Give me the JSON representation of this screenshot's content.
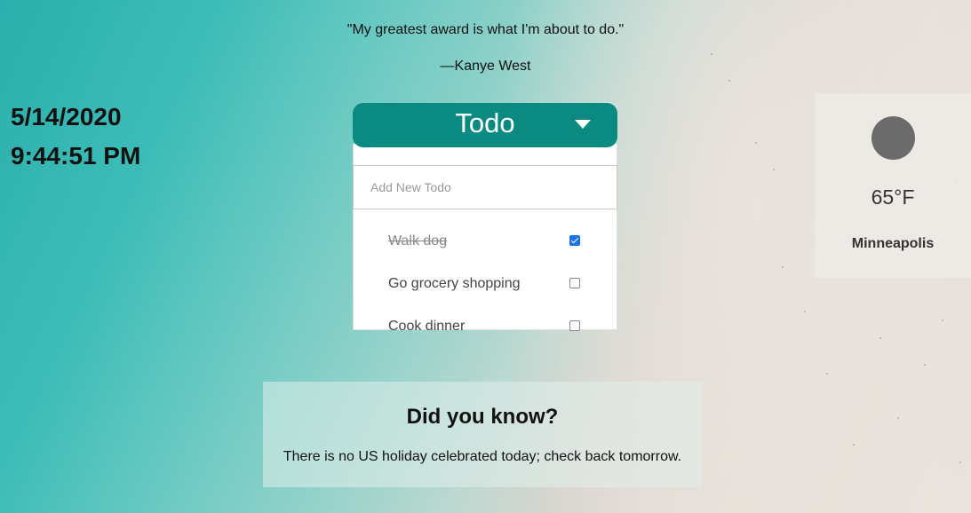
{
  "quote": {
    "text": "\"My greatest award is what I'm about to do.\"",
    "author": "—Kanye West"
  },
  "datetime": {
    "date": "5/14/2020",
    "time": "9:44:51 PM"
  },
  "todo": {
    "title": "Todo",
    "toggle_icon": "caret-down-icon",
    "input_placeholder": "Add New Todo",
    "items": [
      {
        "label": "Walk dog",
        "done": true
      },
      {
        "label": "Go grocery shopping",
        "done": false
      },
      {
        "label": "Cook dinner",
        "done": false
      }
    ],
    "accent_color": "#0a8a80"
  },
  "weather": {
    "icon": "weather-circle-icon",
    "temperature": "65°F",
    "city": "Minneapolis"
  },
  "did_you_know": {
    "title": "Did you know?",
    "text": "There is no US holiday celebrated today; check back tomorrow."
  }
}
